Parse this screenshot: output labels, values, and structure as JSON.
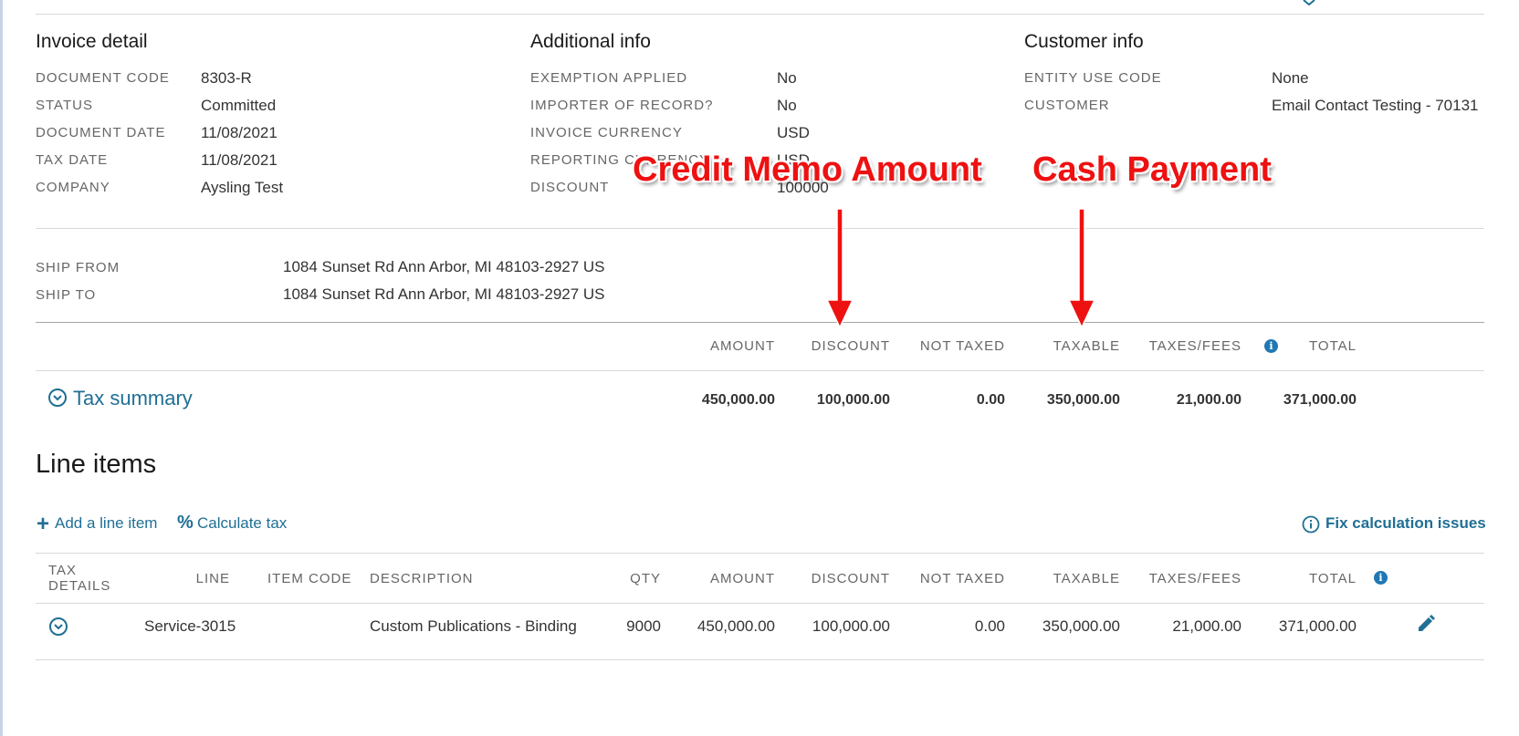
{
  "invoice_detail": {
    "title": "Invoice detail",
    "fields": [
      {
        "label": "DOCUMENT CODE",
        "value": "8303-R"
      },
      {
        "label": "STATUS",
        "value": "Committed"
      },
      {
        "label": "DOCUMENT DATE",
        "value": "11/08/2021"
      },
      {
        "label": "TAX DATE",
        "value": "11/08/2021"
      },
      {
        "label": "COMPANY",
        "value": "Aysling Test"
      }
    ]
  },
  "additional_info": {
    "title": "Additional info",
    "fields": [
      {
        "label": "EXEMPTION APPLIED",
        "value": "No"
      },
      {
        "label": "IMPORTER OF RECORD?",
        "value": "No"
      },
      {
        "label": "INVOICE CURRENCY",
        "value": "USD"
      },
      {
        "label": "REPORTING CURRENCY",
        "value": "USD"
      },
      {
        "label": "DISCOUNT",
        "value": "100000"
      }
    ]
  },
  "customer_info": {
    "title": "Customer info",
    "fields": [
      {
        "label": "ENTITY USE CODE",
        "value": "None"
      },
      {
        "label": "CUSTOMER",
        "value": "Email Contact Testing - 70131"
      }
    ]
  },
  "addresses": {
    "ship_from_label": "SHIP FROM",
    "ship_from": "1084 Sunset Rd Ann Arbor, MI 48103-2927 US",
    "ship_to_label": "SHIP TO",
    "ship_to": "1084 Sunset Rd Ann Arbor, MI 48103-2927 US"
  },
  "summary": {
    "headers": {
      "amount": "AMOUNT",
      "discount": "DISCOUNT",
      "not_taxed": "NOT TAXED",
      "taxable": "TAXABLE",
      "taxes_fees": "TAXES/FEES",
      "total": "TOTAL"
    },
    "link_label": "Tax summary",
    "values": {
      "amount": "450,000.00",
      "discount": "100,000.00",
      "not_taxed": "0.00",
      "taxable": "350,000.00",
      "taxes_fees": "21,000.00",
      "total": "371,000.00"
    }
  },
  "line_items": {
    "title": "Line items",
    "add_label": "Add a line item",
    "calc_label": "Calculate tax",
    "fix_label": "Fix calculation issues",
    "headers": {
      "tax_details_1": "TAX",
      "tax_details_2": "DETAILS",
      "line": "LINE",
      "item_code": "ITEM CODE",
      "description": "DESCRIPTION",
      "qty": "QTY",
      "amount": "AMOUNT",
      "discount": "DISCOUNT",
      "not_taxed": "NOT TAXED",
      "taxable": "TAXABLE",
      "taxes_fees": "TAXES/FEES",
      "total": "TOTAL"
    },
    "rows": [
      {
        "line": "Service-3015",
        "item_code": "",
        "description": "Custom Publications - Binding",
        "qty": "9000",
        "amount": "450,000.00",
        "discount": "100,000.00",
        "not_taxed": "0.00",
        "taxable": "350,000.00",
        "taxes_fees": "21,000.00",
        "total": "371,000.00"
      }
    ]
  },
  "annotations": {
    "credit_memo": "Credit Memo Amount",
    "cash_payment": "Cash Payment"
  },
  "colors": {
    "link": "#1f6f94",
    "info_icon": "#1f78b4",
    "annotation": "#ee1111"
  }
}
